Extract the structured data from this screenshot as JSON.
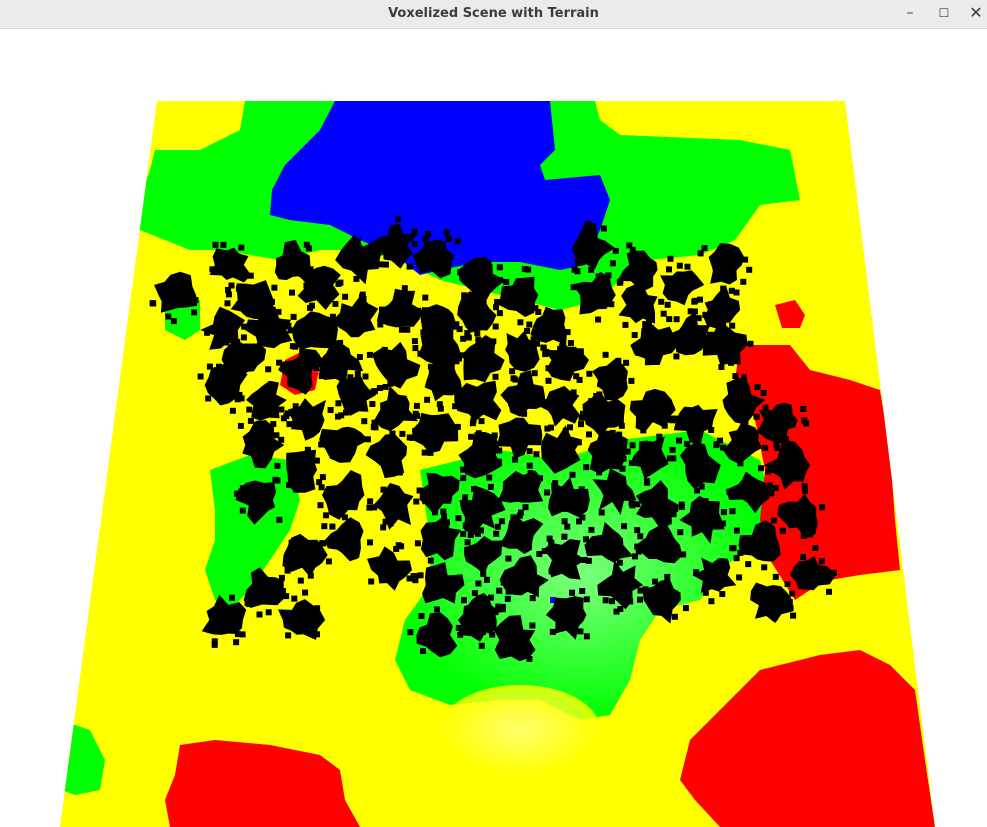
{
  "window": {
    "title": "Voxelized Scene with Terrain",
    "minimize_glyph": "–",
    "maximize_glyph": "☐",
    "close_glyph": "✕",
    "titlebar_color": "#ebebeb"
  },
  "scene": {
    "background_color": "#ffffff",
    "terrain_colors": {
      "high": "#0000ff",
      "mid_high": "#00ff00",
      "mid_low": "#ffff00",
      "low": "#ff0000",
      "tree": "#000000"
    },
    "icons": [
      "terrain-mesh",
      "tree-voxel"
    ]
  }
}
